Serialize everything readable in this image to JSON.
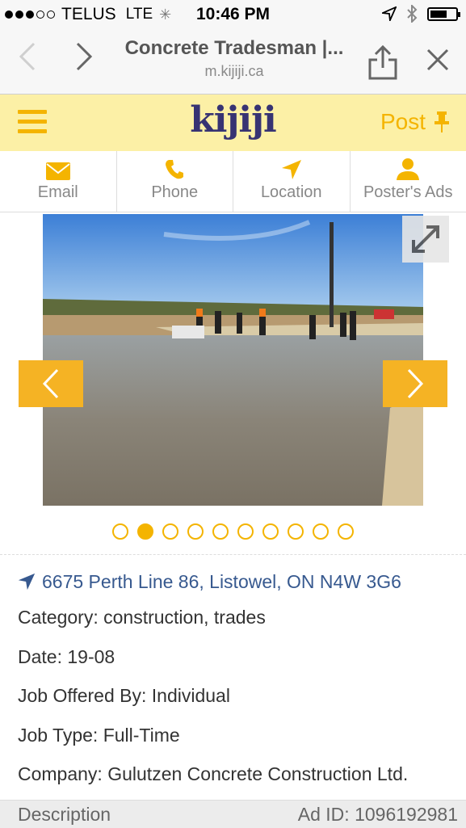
{
  "status": {
    "carrier": "TELUS",
    "network": "LTE",
    "time": "10:46 PM",
    "signal_bars_filled": 3,
    "signal_bars_total": 5
  },
  "browser": {
    "page_title": "Concrete Tradesman |...",
    "url": "m.kijiji.ca"
  },
  "header": {
    "logo": "kijiji",
    "post_label": "Post",
    "accent_color": "#f4b400",
    "logo_color": "#373373"
  },
  "tabs": [
    {
      "label": "Email",
      "icon": "envelope-icon"
    },
    {
      "label": "Phone",
      "icon": "phone-icon"
    },
    {
      "label": "Location",
      "icon": "location-arrow-icon"
    },
    {
      "label": "Poster's Ads",
      "icon": "person-icon"
    }
  ],
  "gallery": {
    "current_index": 2,
    "total": 10
  },
  "details": {
    "address": "6675 Perth Line 86, Listowel, ON N4W 3G6",
    "category": "Category: construction, trades",
    "date": "Date: 19-08",
    "offered_by": "Job Offered By: Individual",
    "job_type": "Job Type: Full-Time",
    "company": "Company: Gulutzen Concrete Construction Ltd."
  },
  "footer": {
    "description_label": "Description",
    "ad_id_label": "Ad ID:",
    "ad_id_value": "1096192981"
  }
}
